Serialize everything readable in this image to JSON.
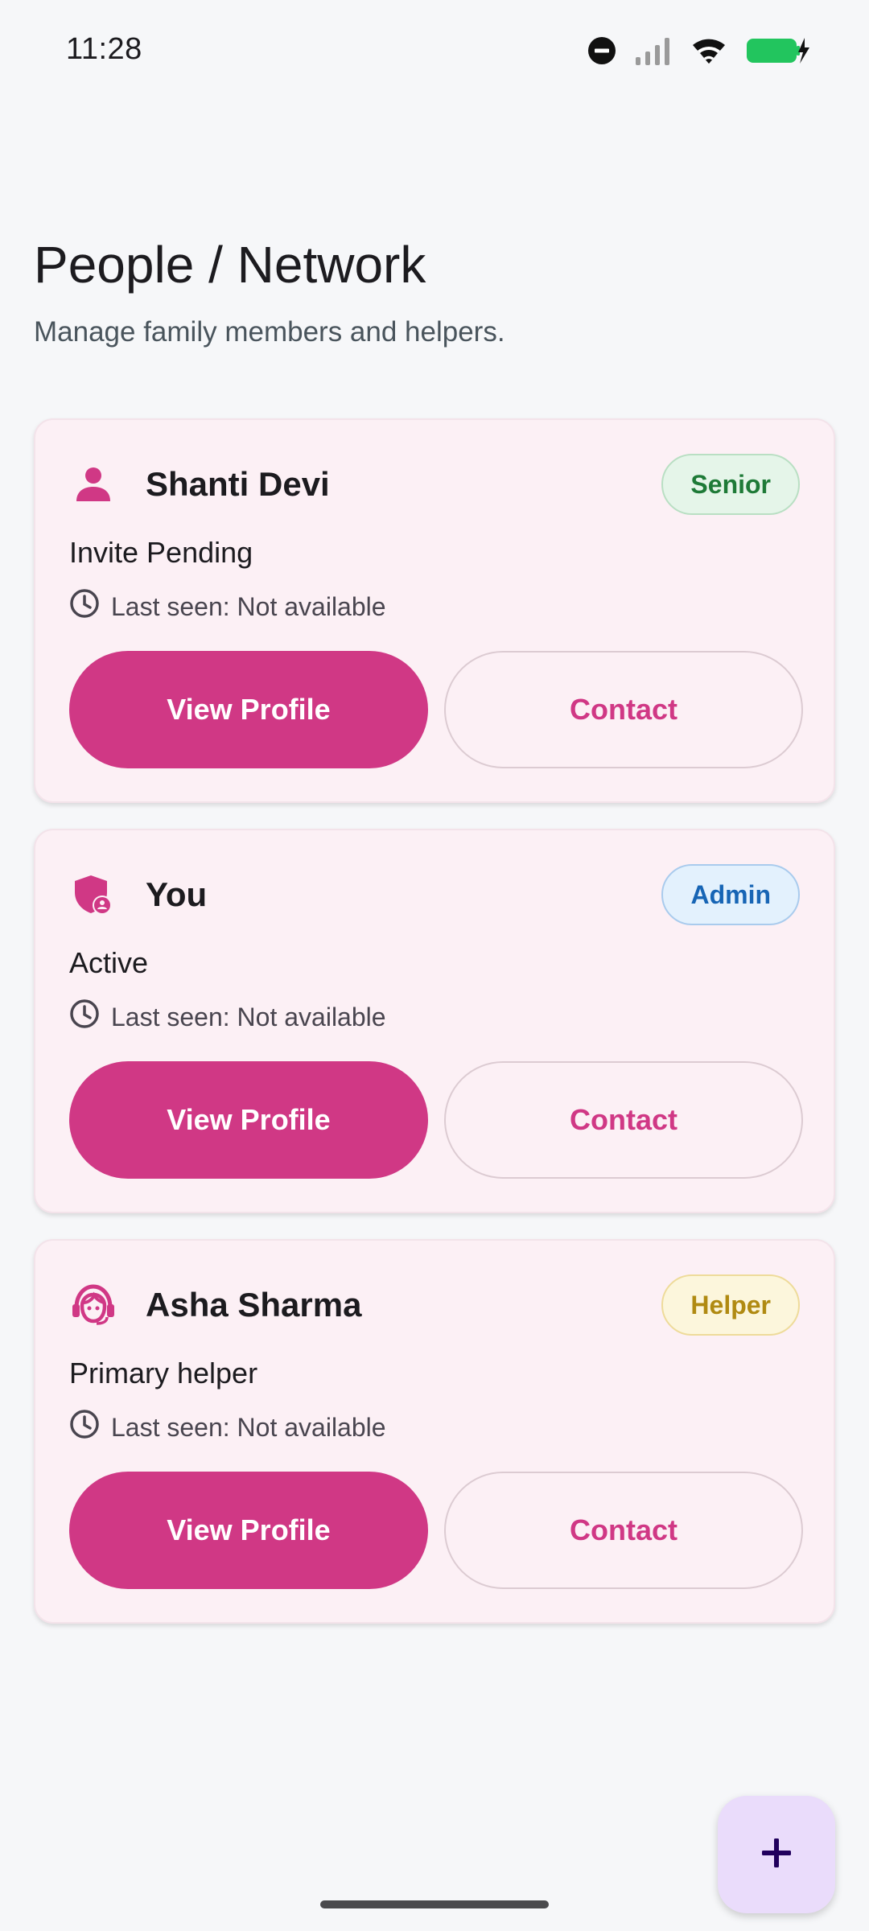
{
  "status_bar": {
    "time": "11:28",
    "icons": [
      "do-not-disturb-icon",
      "signal-icon",
      "wifi-icon",
      "battery-charging-icon"
    ]
  },
  "header": {
    "title": "People / Network",
    "subtitle": "Manage family members and helpers."
  },
  "colors": {
    "accent": "#d03885",
    "card_bg": "#fcf0f5",
    "fab_bg": "#eadcfb"
  },
  "people": [
    {
      "name": "Shanti Devi",
      "icon": "person-icon",
      "badge": "Senior",
      "status": "Invite Pending",
      "last_seen": "Last seen: Not available",
      "primary_action": "View Profile",
      "secondary_action": "Contact"
    },
    {
      "name": "You",
      "icon": "admin-shield-icon",
      "badge": "Admin",
      "status": "Active",
      "last_seen": "Last seen: Not available",
      "primary_action": "View Profile",
      "secondary_action": "Contact"
    },
    {
      "name": "Asha Sharma",
      "icon": "support-agent-icon",
      "badge": "Helper",
      "status": "Primary helper",
      "last_seen": "Last seen: Not available",
      "primary_action": "View Profile",
      "secondary_action": "Contact"
    }
  ],
  "fab": {
    "icon": "add-icon"
  }
}
